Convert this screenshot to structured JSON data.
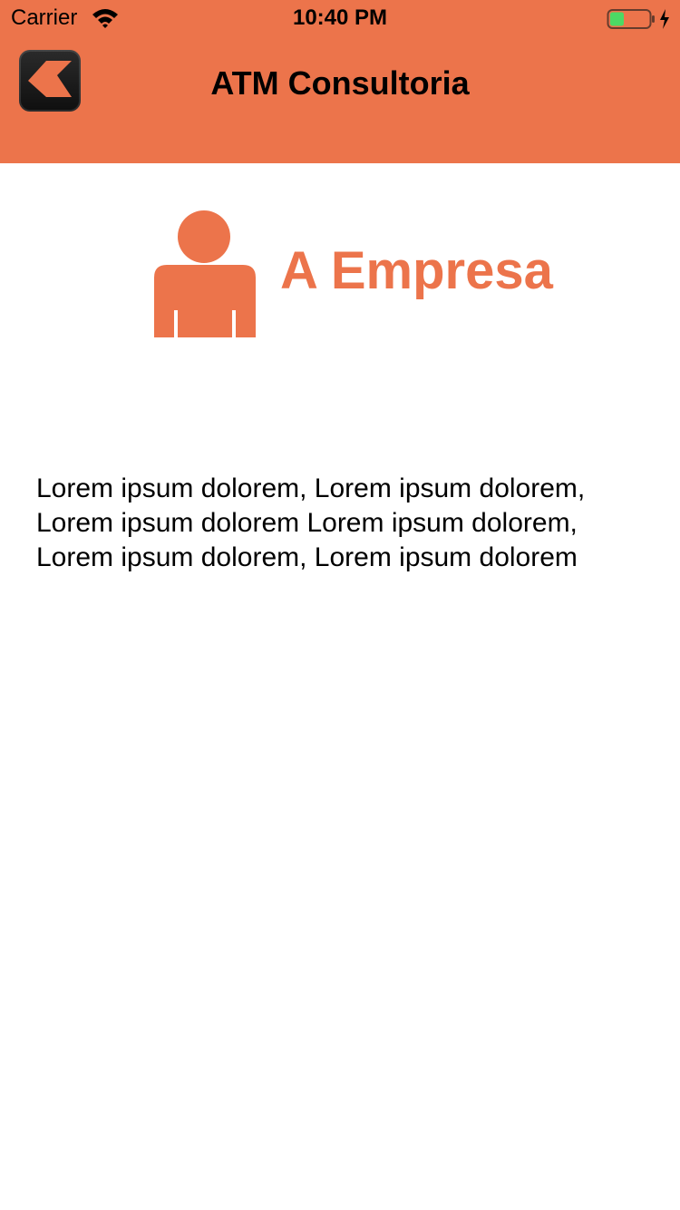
{
  "status_bar": {
    "carrier": "Carrier",
    "time": "10:40 PM",
    "wifi_icon": "wifi-icon",
    "battery_icon": "battery-charging-icon"
  },
  "navbar": {
    "title": "ATM Consultoria",
    "back_icon": "chevron-left-icon",
    "background_color": "#ec744b"
  },
  "content": {
    "section_icon": "person-icon",
    "section_title": "A Empresa",
    "section_title_color": "#ec744b",
    "paragraph": "Lorem ipsum dolorem, Lorem ipsum dolorem, Lorem ipsum dolorem Lorem ipsum dolorem, Lorem ipsum dolorem, Lorem ipsum dolorem"
  }
}
